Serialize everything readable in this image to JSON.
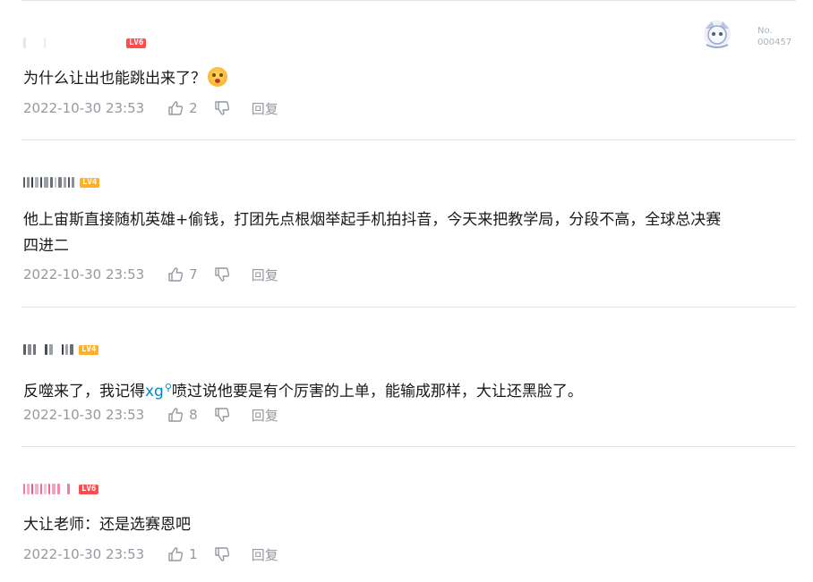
{
  "comments": [
    {
      "level": "LV6",
      "text": "为什么让出也能跳出来了？",
      "has_emoji": true,
      "time": "2022-10-30 23:53",
      "likes": "2",
      "reply_label": "回复",
      "badge": {
        "no_label": "No.",
        "number": "000457"
      }
    },
    {
      "level": "LV4",
      "text_line1": "他上宙斯直接随机英雄+偷钱，打团先点根烟举起手机拍抖音，今天来把教学局，分段不高，全球总决赛",
      "text_line2": "四进二",
      "time": "2022-10-30 23:53",
      "likes": "7",
      "reply_label": "回复"
    },
    {
      "level": "LV4",
      "text_before": "反噬来了，我记得",
      "keyword": "xg",
      "text_after": "喷过说他要是有个厉害的上单，能输成那样，大让还黑脸了。",
      "time": "2022-10-30 23:53",
      "likes": "8",
      "reply_label": "回复"
    },
    {
      "level": "LV6",
      "text": "大让老师：还是选赛恩吧",
      "time": "2022-10-30 23:53",
      "likes": "1",
      "reply_label": "回复"
    }
  ],
  "icons": {
    "like": "thumbs-up-icon",
    "dislike": "thumbs-down-icon",
    "search": "search-icon",
    "emoji": "flushed-face-emoji"
  },
  "colors": {
    "meta": "#9499a0",
    "keyword": "#008ac5",
    "divider": "#e3e5e7",
    "lv6": "#ff4d4f",
    "lv4": "#ffb027"
  }
}
